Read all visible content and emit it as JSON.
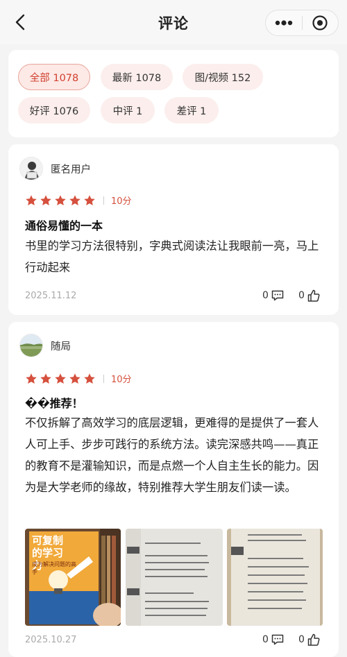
{
  "header": {
    "title": "评论"
  },
  "filters": [
    {
      "label": "全部 1078",
      "active": true
    },
    {
      "label": "最新 1078",
      "active": false
    },
    {
      "label": "图/视频 152",
      "active": false
    },
    {
      "label": "好评 1076",
      "active": false
    },
    {
      "label": "中评 1",
      "active": false
    },
    {
      "label": "差评 1",
      "active": false
    }
  ],
  "reviews": [
    {
      "user": "匿名用户",
      "stars": 5,
      "score": "10分",
      "title": "通俗易懂的一本",
      "body": "书里的学习方法很特别，字典式阅读法让我眼前一亮，马上行动起来",
      "date": "2025.11.12",
      "comments": "0",
      "likes": "0"
    },
    {
      "user": "随局",
      "stars": 5,
      "score": "10分",
      "title": "��推荐！",
      "body": "不仅拆解了高效学习的底层逻辑，更难得的是提供了一套人人可上手、步步可践行的系统方法。读完深感共鸣——真正的教育不是灌输知识，而是点燃一个人自主生长的能力。因为是大学老师的缘故，特别推荐大学生朋友们读一读。",
      "date": "2025.10.27",
      "comments": "0",
      "likes": "0",
      "photo_book_title": "可复制的学习力",
      "photo_book_subtitle": "成为解决问题的高手"
    }
  ],
  "colors": {
    "accent": "#d5503d",
    "chip_bg": "#fbeeec",
    "page_bg": "#f4f4f4"
  },
  "icons": {
    "back": "chevron-left-icon",
    "more": "more-dots-icon",
    "target": "target-icon",
    "comment": "comment-icon",
    "like": "thumb-up-icon"
  }
}
